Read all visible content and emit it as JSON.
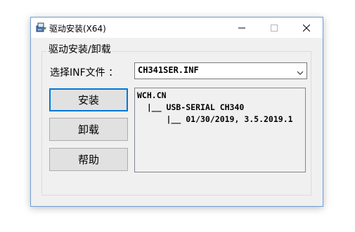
{
  "window": {
    "title": "驱动安装(X64)",
    "icon": "installer-icon",
    "controls": {
      "minimize": "minimize-icon",
      "maximize": "maximize-icon",
      "close": "close-icon"
    }
  },
  "group": {
    "label": "驱动安装/卸载"
  },
  "inf": {
    "label": "选择INF文件 ：",
    "selected": "CH341SER.INF"
  },
  "buttons": {
    "install": "安装",
    "uninstall": "卸载",
    "help": "帮助"
  },
  "info": {
    "lines": [
      "WCH.CN",
      "  |__ USB-SERIAL CH340",
      "      |__ 01/30/2019, 3.5.2019.1"
    ]
  },
  "colors": {
    "accent": "#0078d7",
    "window_border": "#6e9fd2",
    "dialog_bg": "#f0f0f0"
  }
}
